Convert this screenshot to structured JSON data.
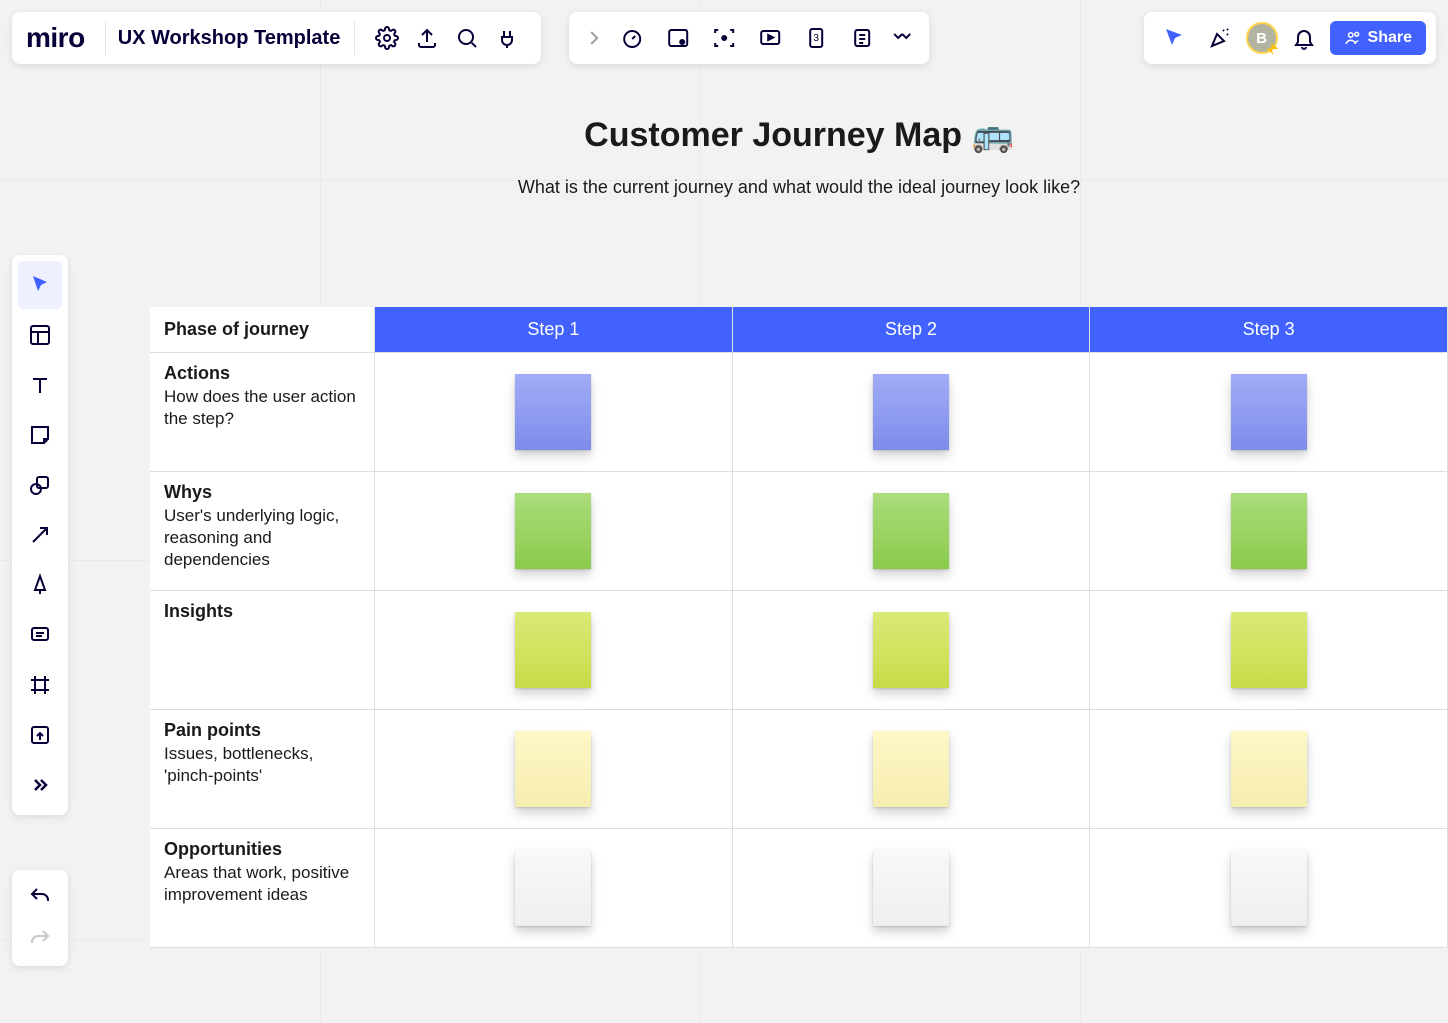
{
  "app": {
    "logo": "miro",
    "board_title": "UX Workshop Template"
  },
  "top_center_tools": {
    "timer": "timer-icon",
    "attention": "attention-icon",
    "focus": "focus-icon",
    "present": "present-icon",
    "estimate": "estimate-icon",
    "notes": "notes-icon",
    "more": "chevron-down-icon"
  },
  "top_right": {
    "cursor_tracking": "cursor-icon",
    "reactions": "confetti-icon",
    "avatar_initial": "B",
    "bell": "bell-icon",
    "share_label": "Share"
  },
  "heading": {
    "title": "Customer Journey Map 🚌",
    "subtitle": "What is the current journey and what would the ideal journey look like?"
  },
  "table": {
    "label_header": "Phase of journey",
    "steps": [
      "Step 1",
      "Step 2",
      "Step 3"
    ],
    "rows": [
      {
        "title": "Actions",
        "desc": "How does the user action the step?",
        "color": "blue"
      },
      {
        "title": "Whys",
        "desc": "User's underlying logic, reasoning and dependencies",
        "color": "green"
      },
      {
        "title": "Insights",
        "desc": "",
        "color": "yellow"
      },
      {
        "title": "Pain points",
        "desc": "Issues, bottlenecks, 'pinch-points'",
        "color": "cream"
      },
      {
        "title": "Opportunities",
        "desc": "Areas that work, positive improvement ideas",
        "color": "white"
      }
    ]
  }
}
